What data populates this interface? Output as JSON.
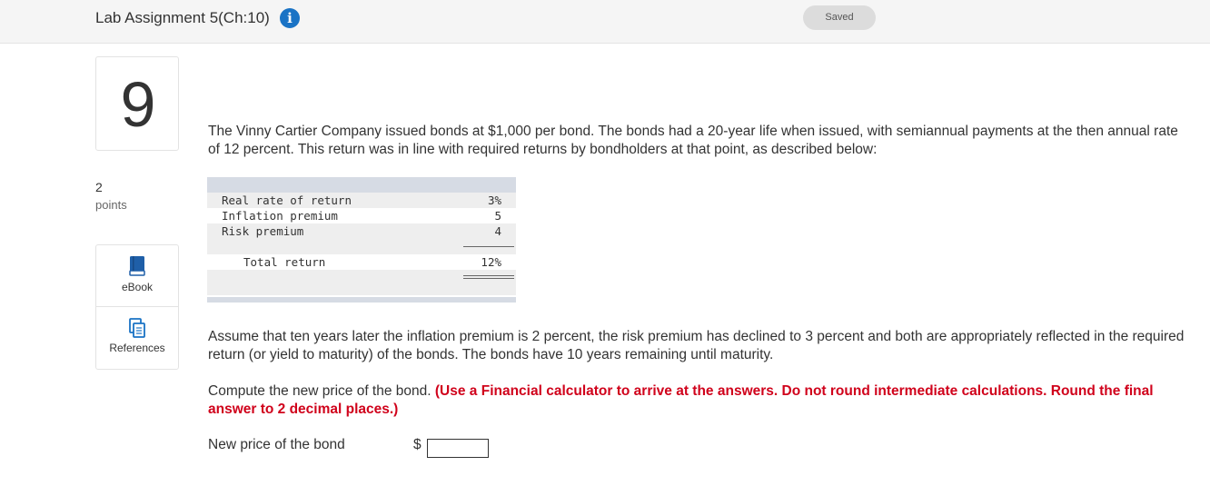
{
  "header": {
    "title": "Lab Assignment 5(Ch:10)",
    "info_icon": "info-circle-icon",
    "saved_label": "Saved"
  },
  "question": {
    "number": "9",
    "points_value": "2",
    "points_label": "points"
  },
  "tools": {
    "ebook_label": "eBook",
    "ebook_icon": "book-icon",
    "references_label": "References",
    "references_icon": "copy-pages-icon"
  },
  "body": {
    "intro": "The Vinny Cartier Company issued bonds at $1,000 per bond. The bonds had a 20-year life when issued, with semiannual payments at the then annual rate of 12 percent. This return was in line with required returns by bondholders at that point, as described below:",
    "scenario": "Assume that ten years later the inflation premium is 2 percent, the risk premium has declined to 3 percent and both are appropriately reflected in the required return (or yield to maturity) of the bonds. The bonds have 10 years remaining until maturity.",
    "instruction_plain": "Compute the new price of the bond. ",
    "instruction_red": "(Use a Financial calculator to arrive at the answers. Do not round intermediate calculations. Round the final answer to 2 decimal places.)"
  },
  "return_table": {
    "rows": [
      {
        "label": "Real rate of return",
        "value": "3%"
      },
      {
        "label": "Inflation premium",
        "value": "5"
      },
      {
        "label": "Risk premium",
        "value": "4"
      }
    ],
    "total_label": "Total return",
    "total_value": "12%"
  },
  "answer": {
    "label": "New price of the bond",
    "currency": "$",
    "value": ""
  },
  "colors": {
    "accent_blue": "#1a73c5",
    "instruction_red": "#d0021b",
    "table_band_blue": "#d6dbe4",
    "table_band_gray": "#eeeeee"
  }
}
